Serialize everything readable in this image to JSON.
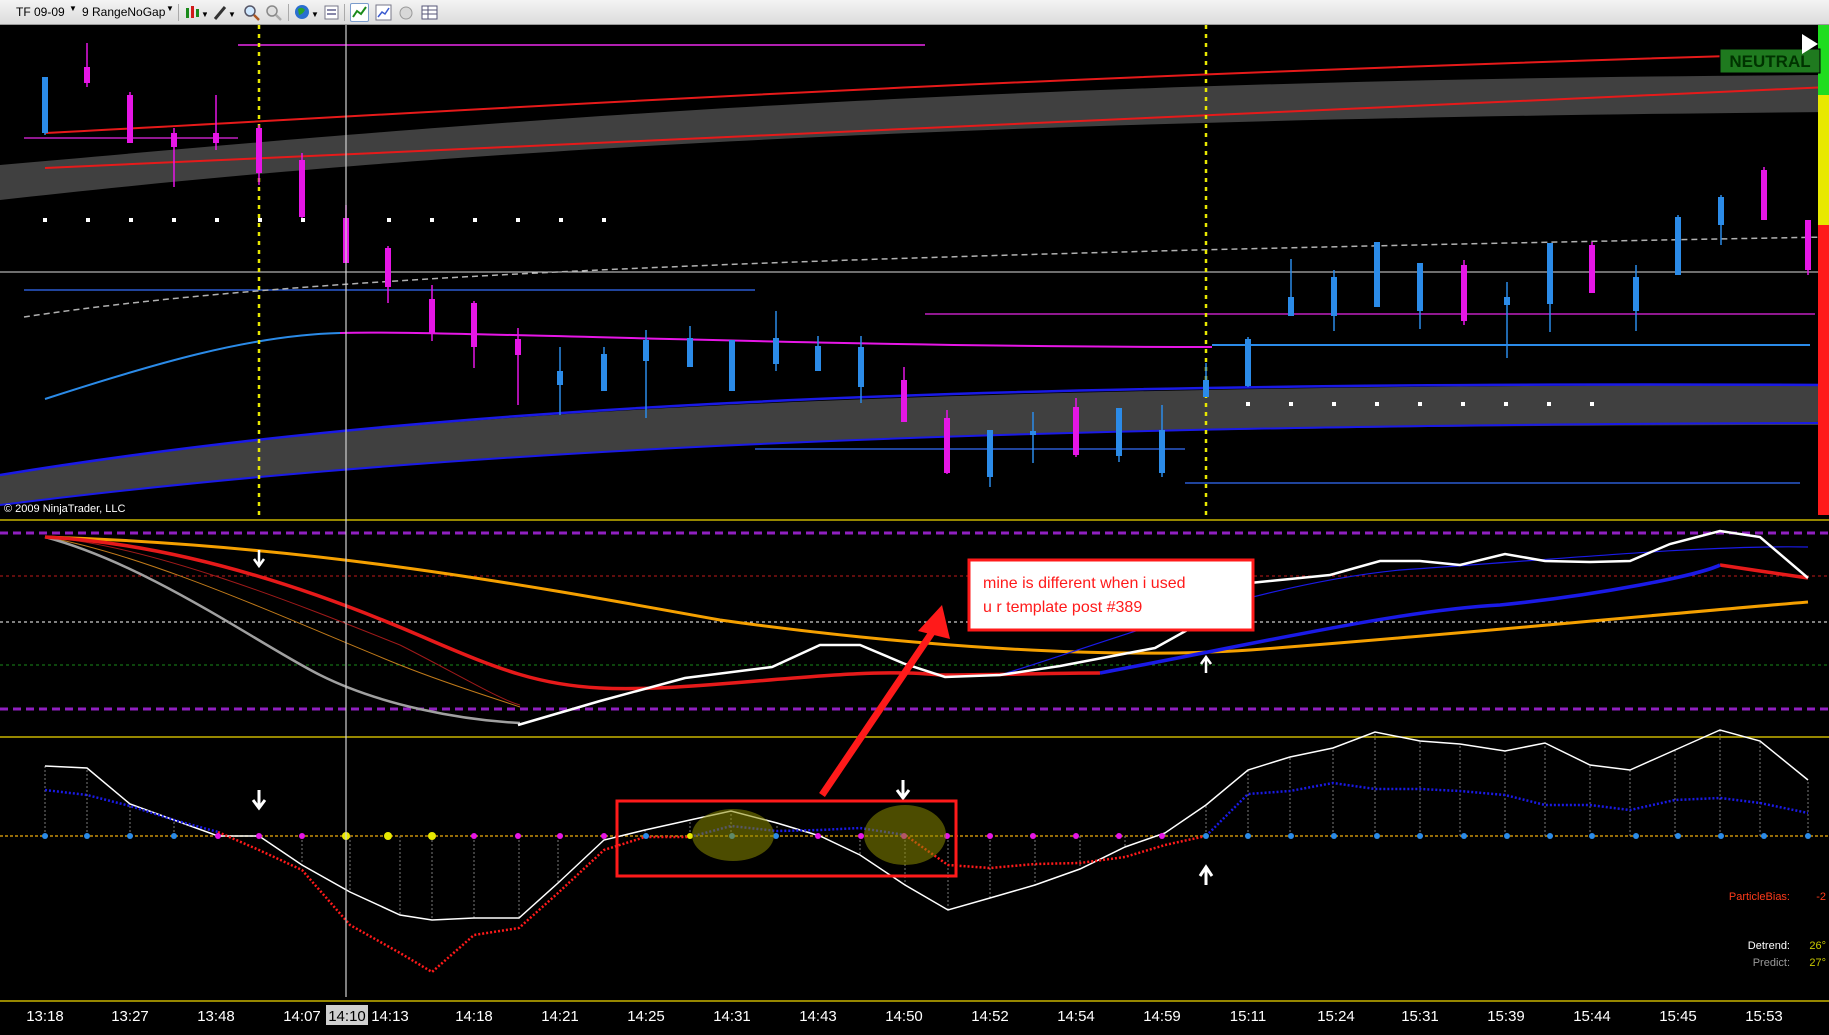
{
  "toolbar": {
    "instrument": "TF 09-09",
    "period": "9 RangeNoGap",
    "icons": [
      "bar-style-icon",
      "draw-pencil-icon",
      "zoom-in-icon",
      "zoom-out-icon",
      "globe-icon",
      "properties-icon",
      "indicator-icon",
      "strategy-icon",
      "circle-icon",
      "data-box-icon"
    ]
  },
  "chart": {
    "copyright": "© 2009 NinjaTrader, LLC",
    "status_badge": "NEUTRAL",
    "note": "mine is different when i used\nu r template post #389",
    "note_line1": "mine is different when i used",
    "note_line2": "u r template post #389",
    "cursor_time": "14:10",
    "x_labels": [
      "13:18",
      "13:27",
      "13:48",
      "14:07",
      "14:13",
      "14:18",
      "14:21",
      "14:25",
      "14:31",
      "14:43",
      "14:50",
      "14:52",
      "14:54",
      "14:59",
      "15:11",
      "15:24",
      "15:31",
      "15:39",
      "15:44",
      "15:45",
      "15:53"
    ],
    "readouts": [
      {
        "label": "ParticleBias:",
        "value": "-2",
        "color": "#ff3a1a"
      },
      {
        "label": "Detrend:",
        "value": "26°",
        "color": "#ffffff",
        "value_color": "#c8c800"
      },
      {
        "label": "Predict:",
        "value": "27°",
        "color": "#9a9a9a",
        "value_color": "#c8c800"
      }
    ],
    "colors": {
      "bull": "#2b8be8",
      "bear": "#e616e6",
      "upper_band": "#e61a1a",
      "lower_band": "#1a1ae6",
      "band_fill": "#404040",
      "neutral_bg": "#1f7a1f",
      "neutral_text": "#003300",
      "note_border": "#ff1a1a",
      "arrow": "#ff1a1a"
    }
  }
}
